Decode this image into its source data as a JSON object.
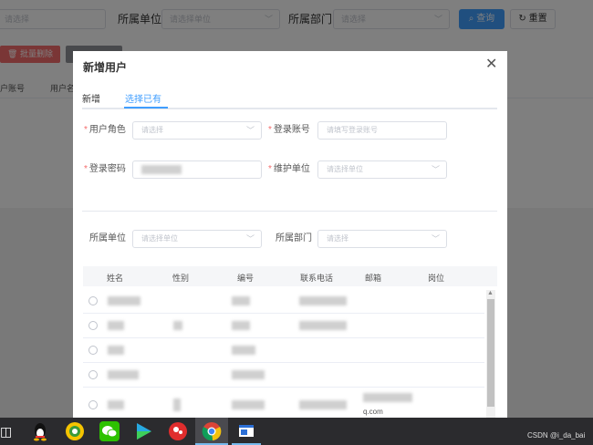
{
  "page": {
    "filter": {
      "select_placeholder": "请选择",
      "unit_label": "所属单位",
      "unit_placeholder": "请选择单位",
      "dept_label": "所属部门",
      "dept_placeholder": "请选择",
      "search_label": "查询",
      "reset_label": "重置"
    },
    "batch_delete_label": "批量删除",
    "table_headers": [
      "户账号",
      "用户名"
    ]
  },
  "dialog": {
    "title": "新增用户",
    "tabs": [
      {
        "label": "新增",
        "active": false
      },
      {
        "label": "选择已有",
        "active": true
      }
    ],
    "form": {
      "role_label": "用户角色",
      "role_placeholder": "请选择",
      "account_label": "登录账号",
      "account_placeholder": "请填写登录账号",
      "password_label": "登录密码",
      "maintain_unit_label": "维护单位",
      "maintain_unit_placeholder": "请选择单位"
    },
    "search": {
      "unit_label": "所属单位",
      "unit_placeholder": "请选择单位",
      "dept_label": "所属部门",
      "dept_placeholder": "请选择"
    },
    "table": {
      "headers": [
        "姓名",
        "性别",
        "编号",
        "联系电话",
        "邮箱",
        "岗位"
      ],
      "partial_email": "q.com"
    }
  },
  "taskbar": {
    "icons": [
      "task-view-icon",
      "qq-icon",
      "game-icon",
      "wechat-icon",
      "video-player-icon",
      "red-app-icon",
      "chrome-icon",
      "window-app-icon"
    ]
  },
  "watermark": "CSDN @i_da_bai",
  "colors": {
    "primary": "#409eff",
    "danger": "#f56c6c",
    "required": "#f56c6c"
  }
}
